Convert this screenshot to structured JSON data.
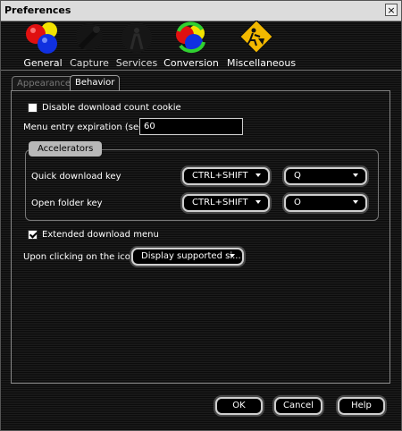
{
  "window": {
    "title": "Preferences",
    "close_symbol": "×"
  },
  "toolbar": {
    "items": [
      {
        "label": "General",
        "icon": "rgb-balls-icon",
        "selected": true
      },
      {
        "label": "Capture",
        "icon": "capture-icon",
        "selected": false
      },
      {
        "label": "Services",
        "icon": "services-icon",
        "selected": false
      },
      {
        "label": "Conversion",
        "icon": "conversion-icon",
        "selected": false
      },
      {
        "label": "Miscellaneous",
        "icon": "warning-sign-icon",
        "selected": false
      }
    ]
  },
  "tabs": [
    {
      "label": "Appearance",
      "active": false
    },
    {
      "label": "Behavior",
      "active": true
    }
  ],
  "behavior": {
    "disable_cookie": {
      "label": "Disable download count cookie",
      "checked": false
    },
    "expiration": {
      "label": "Menu entry expiration (sec)",
      "value": "60"
    },
    "accelerators": {
      "title": "Accelerators",
      "quick_download": {
        "label": "Quick download key",
        "modifier": "CTRL+SHIFT",
        "key": "Q"
      },
      "open_folder": {
        "label": "Open folder key",
        "modifier": "CTRL+SHIFT",
        "key": "O"
      }
    },
    "extended_menu": {
      "label": "Extended download menu",
      "checked": true
    },
    "icon_click": {
      "label": "Upon clicking on the icon",
      "value": "Display supported si..."
    }
  },
  "buttons": {
    "ok": "OK",
    "cancel": "Cancel",
    "help": "Help"
  },
  "colors": {
    "background": "#111111",
    "text": "#ffffff",
    "button_border": "#cfcfcf"
  }
}
